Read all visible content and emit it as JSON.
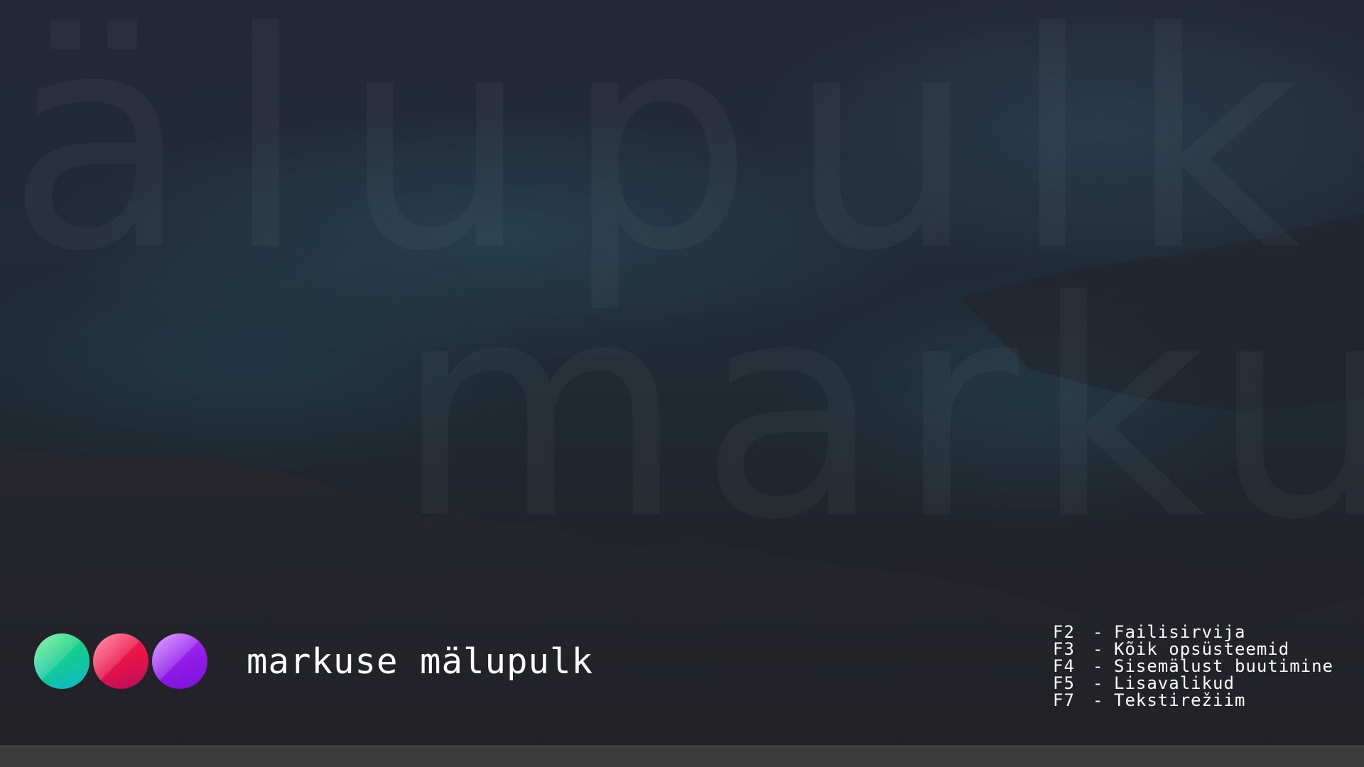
{
  "background": {
    "watermark_top": "älupulk",
    "watermark_bottom": "markus"
  },
  "brand": {
    "title": "markuse mälupulk",
    "dots": [
      {
        "name": "green",
        "color": "#14e05a"
      },
      {
        "name": "red",
        "color": "#ff1a4a"
      },
      {
        "name": "purple",
        "color": "#8f1be6"
      }
    ]
  },
  "menu": {
    "items": [
      {
        "key": "F2",
        "dash": "-",
        "label": "Failisirvija"
      },
      {
        "key": "F3",
        "dash": "-",
        "label": "Kõik opsüsteemid"
      },
      {
        "key": "F4",
        "dash": "-",
        "label": "Sisemälust buutimine"
      },
      {
        "key": "F5",
        "dash": "-",
        "label": "Lisavalikud"
      },
      {
        "key": "F7",
        "dash": "-",
        "label": "Tekstirežiim"
      }
    ]
  },
  "colors": {
    "footer_bar": "#3c3c3c",
    "text": "#ffffff"
  }
}
